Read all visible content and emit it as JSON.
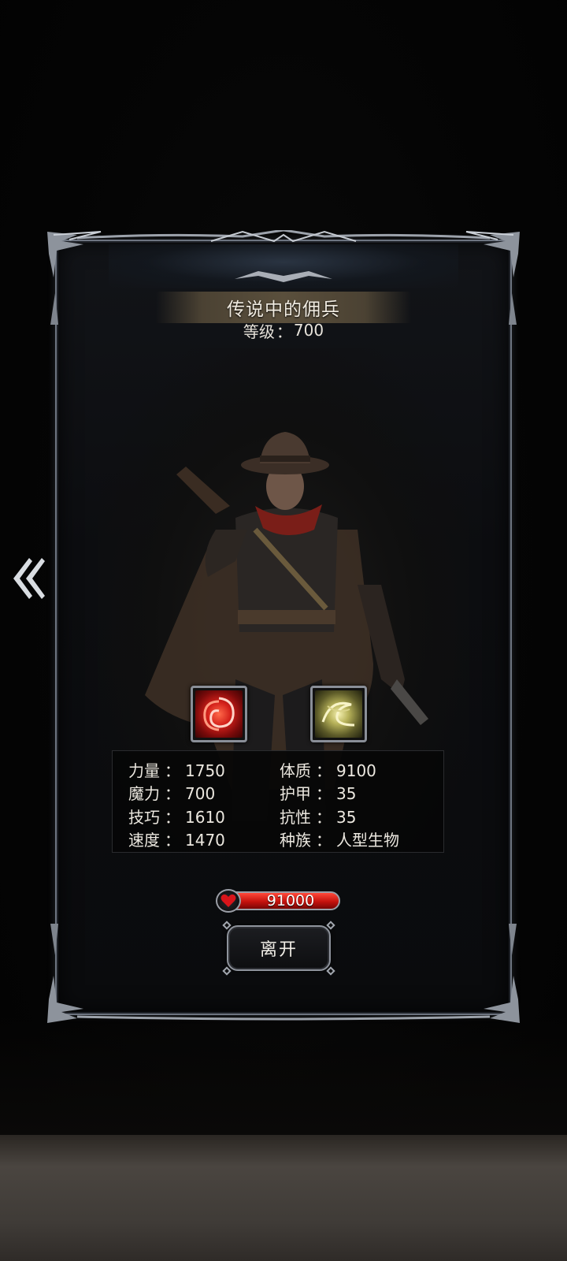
{
  "unit": {
    "name": "传说中的佣兵",
    "level_label": "等级",
    "level_separator": "：",
    "level_value": "700"
  },
  "skills": [
    {
      "icon": "red-vortex-skill-icon",
      "color": "#d3201a"
    },
    {
      "icon": "yellow-swirl-skill-icon",
      "color": "#b7b25a"
    }
  ],
  "stats": {
    "separator": "：",
    "left": [
      {
        "label": "力量",
        "value": "1750"
      },
      {
        "label": "魔力",
        "value": "700"
      },
      {
        "label": "技巧",
        "value": "1610"
      },
      {
        "label": "速度",
        "value": "1470"
      }
    ],
    "right": [
      {
        "label": "体质",
        "value": "9100"
      },
      {
        "label": "护甲",
        "value": "35"
      },
      {
        "label": "抗性",
        "value": "35"
      },
      {
        "label": "种族",
        "value": "人型生物"
      }
    ]
  },
  "hp": {
    "value": "91000",
    "icon": "heart-icon",
    "color": "#c5120d"
  },
  "actions": {
    "leave_label": "离开",
    "back_icon": "double-chevron-left-icon"
  },
  "colors": {
    "frame": "#6d7480",
    "title_bar": "#5a4f3c",
    "text": "#ece8e0"
  }
}
